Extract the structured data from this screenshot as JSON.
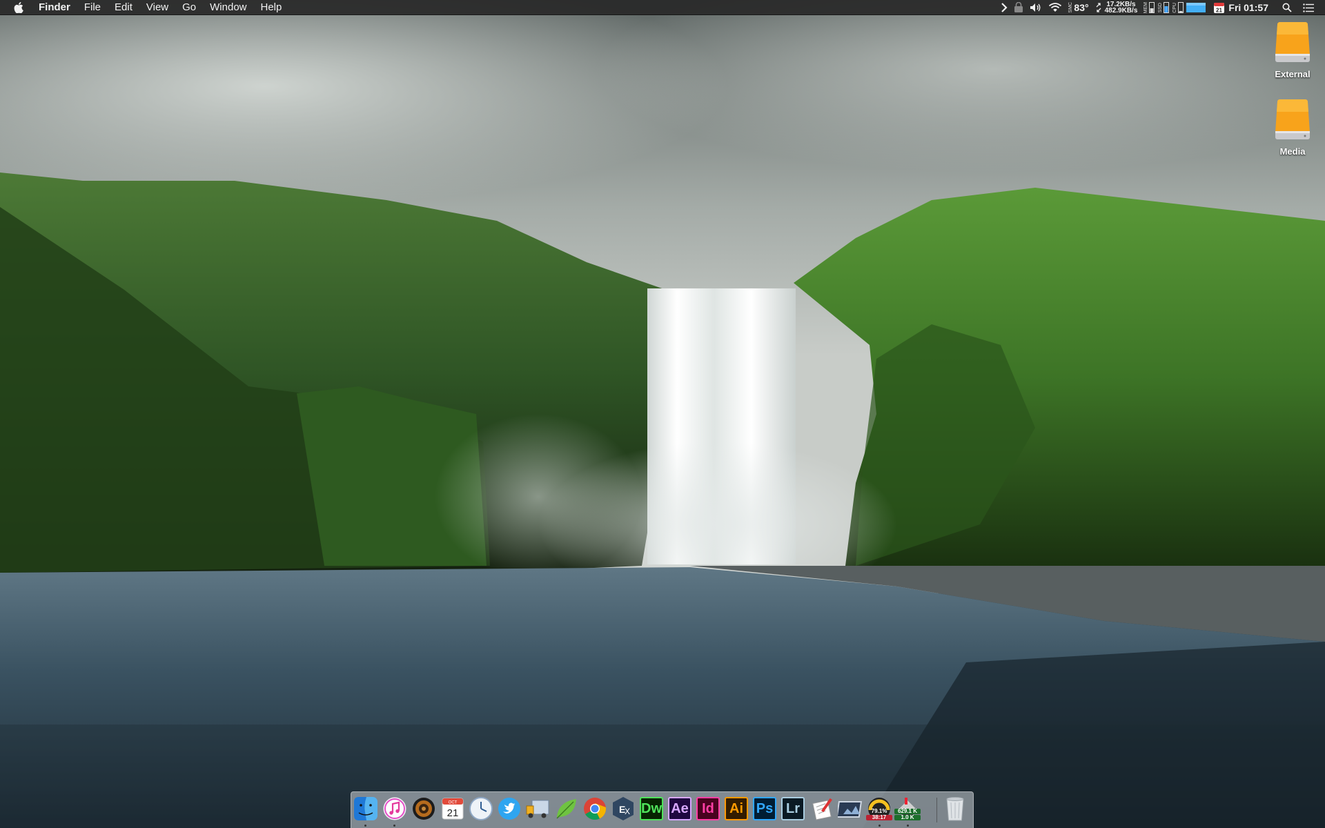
{
  "menubar": {
    "apple_icon": "apple-logo",
    "app_name": "Finder",
    "menus": [
      "File",
      "Edit",
      "View",
      "Go",
      "Window",
      "Help"
    ],
    "status": {
      "temperature": "83°",
      "net_up": "17.2KB/s",
      "net_down": "482.9KB/s",
      "mem_label": "MEM",
      "ssd_label": "SSD",
      "cpu_label": "CPU",
      "calendar_day": "21",
      "clock": "Fri 01:57"
    }
  },
  "desktop": {
    "icons": [
      {
        "label": "External",
        "icon": "external-drive-icon"
      },
      {
        "label": "Media",
        "icon": "media-drive-icon"
      }
    ]
  },
  "dock": {
    "apps": [
      {
        "name": "Finder",
        "running": true
      },
      {
        "name": "iTunes",
        "running": true
      },
      {
        "name": "Speakers",
        "running": false
      },
      {
        "name": "Calendar",
        "month": "OCT",
        "day": "21",
        "running": false
      },
      {
        "name": "Time",
        "running": false
      },
      {
        "name": "Twitter",
        "running": false
      },
      {
        "name": "Transmit",
        "running": false
      },
      {
        "name": "Leaf",
        "running": false
      },
      {
        "name": "Chrome",
        "running": false
      },
      {
        "name": "ExpanDrive",
        "running": false
      },
      {
        "name": "Dreamweaver",
        "abbr": "Dw",
        "running": false
      },
      {
        "name": "After Effects",
        "abbr": "Ae",
        "running": false
      },
      {
        "name": "InDesign",
        "abbr": "Id",
        "running": false
      },
      {
        "name": "Illustrator",
        "abbr": "Ai",
        "running": false
      },
      {
        "name": "Photoshop",
        "abbr": "Ps",
        "running": false
      },
      {
        "name": "Lightroom",
        "abbr": "Lr",
        "running": false
      },
      {
        "name": "TextEdit",
        "running": false
      },
      {
        "name": "Screenshot",
        "running": false
      },
      {
        "name": "Stats Monitor",
        "line1": "79.1%",
        "line2": "38:17",
        "running": true
      },
      {
        "name": "Network Monitor",
        "line1": "629.1 K",
        "line2": "1.0 K",
        "running": true
      },
      {
        "name": "Trash",
        "running": false
      }
    ]
  },
  "colors": {
    "dreamweaver": "#4fe35b",
    "after_effects": "#d8a8ff",
    "indesign": "#ff3ea5",
    "illustrator": "#ff9a00",
    "photoshop": "#31a8ff",
    "lightroom": "#a9cde0"
  }
}
